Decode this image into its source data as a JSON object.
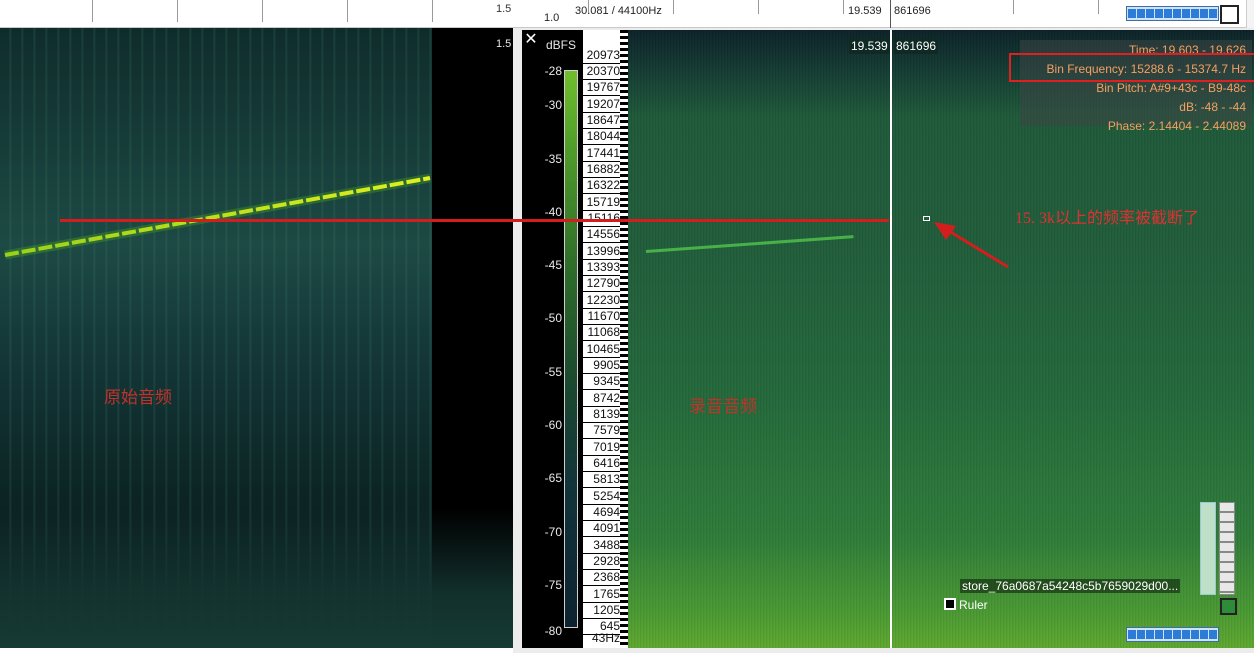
{
  "left_pane": {
    "ruler_label": "1.5",
    "overlay_label": "原始音频"
  },
  "right_pane": {
    "zoom_level": "1.0",
    "position_and_rate": "30.081 / 44100Hz",
    "ruler_time": "19.539",
    "ruler_sample": "861696",
    "left_marker_label": "1.5",
    "close_glyph": "✕",
    "dbfs": {
      "title": "dBFS",
      "ticks": [
        "-28",
        "-30",
        "-35",
        "-40",
        "-45",
        "-50",
        "-55",
        "-60",
        "-65",
        "-70",
        "-75",
        "-80"
      ]
    },
    "frequency_ticks": [
      "20973",
      "20370",
      "19767",
      "19207",
      "18647",
      "18044",
      "17441",
      "16882",
      "16322",
      "15719",
      "15116",
      "14556",
      "13996",
      "13393",
      "12790",
      "12230",
      "11670",
      "11068",
      "10465",
      "9905",
      "9345",
      "8742",
      "8139",
      "7579",
      "7019",
      "6416",
      "5813",
      "5254",
      "4694",
      "4091",
      "3488",
      "2928",
      "2368",
      "1765",
      "1205",
      "645",
      "43Hz"
    ],
    "time_chip_1": "19.539",
    "time_chip_2": "861696",
    "info": {
      "time": "Time: 19.603 - 19.626",
      "bin_frequency": "Bin Frequency: 15288.6 - 15374.7 Hz",
      "bin_pitch": "Bin Pitch: A#9+43c - B9-48c",
      "db": "dB: -48 - -44",
      "phase": "Phase: 2.14404 - 2.44089"
    },
    "annotation": "15. 3k以上的频率被截断了",
    "overlay_label": "录音音频",
    "store_label": "store_76a0687a54248c5b7659029d00...",
    "ruler_checkbox_label": "Ruler"
  },
  "colors": {
    "annotation_red": "#d41e1e",
    "info_text": "#f4a060",
    "spectrum_signal": "#c8e020"
  }
}
